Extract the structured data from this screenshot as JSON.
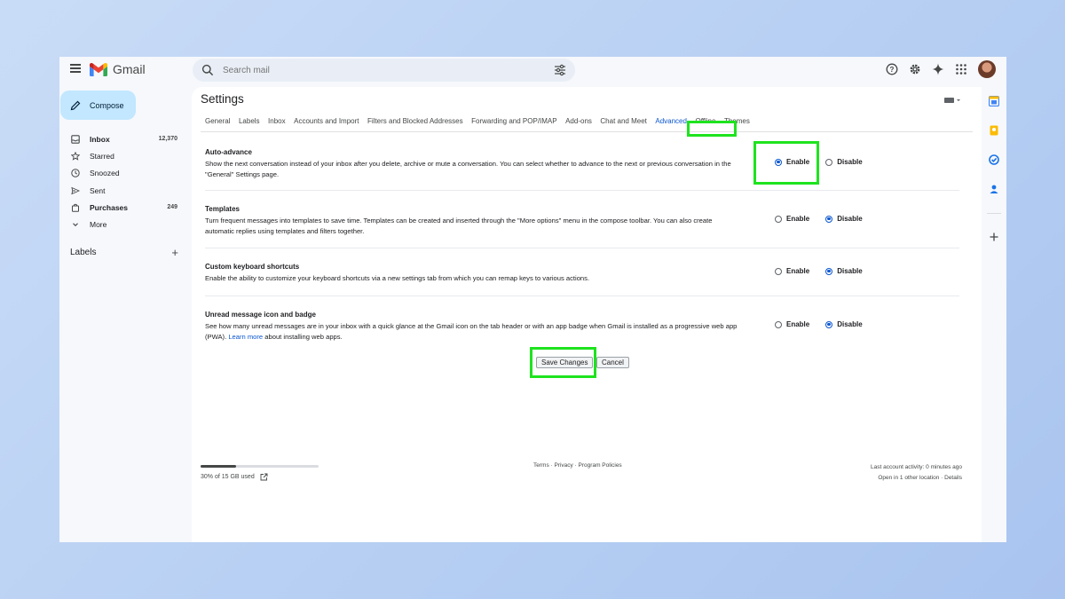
{
  "app": {
    "name": "Gmail"
  },
  "search": {
    "placeholder": "Search mail"
  },
  "compose": {
    "label": "Compose"
  },
  "sidebar": {
    "items": [
      {
        "label": "Inbox",
        "count": "12,370",
        "icon": "inbox-icon",
        "bold": true
      },
      {
        "label": "Starred",
        "count": "",
        "icon": "star-icon",
        "bold": false
      },
      {
        "label": "Snoozed",
        "count": "",
        "icon": "clock-icon",
        "bold": false
      },
      {
        "label": "Sent",
        "count": "",
        "icon": "send-icon",
        "bold": false
      },
      {
        "label": "Purchases",
        "count": "249",
        "icon": "bag-icon",
        "bold": true
      },
      {
        "label": "More",
        "count": "",
        "icon": "chevron-down-icon",
        "bold": false
      }
    ],
    "labels_header": "Labels"
  },
  "settings": {
    "title": "Settings",
    "tabs": [
      "General",
      "Labels",
      "Inbox",
      "Accounts and Import",
      "Filters and Blocked Addresses",
      "Forwarding and POP/IMAP",
      "Add-ons",
      "Chat and Meet",
      "Advanced",
      "Offline",
      "Themes"
    ],
    "active_tab": "Advanced",
    "rows": [
      {
        "title": "Auto-advance",
        "desc": "Show the next conversation instead of your inbox after you delete, archive or mute a conversation. You can select whether to advance to the next or previous conversation in the \"General\" Settings page.",
        "enable_label": "Enable",
        "disable_label": "Disable",
        "selected": "enable"
      },
      {
        "title": "Templates",
        "desc": "Turn frequent messages into templates to save time. Templates can be created and inserted through the \"More options\" menu in the compose toolbar. You can also create automatic replies using templates and filters together.",
        "enable_label": "Enable",
        "disable_label": "Disable",
        "selected": "disable"
      },
      {
        "title": "Custom keyboard shortcuts",
        "desc": "Enable the ability to customize your keyboard shortcuts via a new settings tab from which you can remap keys to various actions.",
        "enable_label": "Enable",
        "disable_label": "Disable",
        "selected": "disable"
      },
      {
        "title": "Unread message icon and badge",
        "desc": "See how many unread messages are in your inbox with a quick glance at the Gmail icon on the tab header or with an app badge when Gmail is installed as a progressive web app (PWA).",
        "link": "Learn more",
        "desc_after": "about installing web apps.",
        "enable_label": "Enable",
        "disable_label": "Disable",
        "selected": "disable"
      }
    ],
    "save_label": "Save Changes",
    "cancel_label": "Cancel"
  },
  "footer": {
    "storage_text": "30% of 15 GB used",
    "storage_fraction": 0.3,
    "links": "Terms · Privacy · Program Policies",
    "activity_line1": "Last account activity: 0 minutes ago",
    "activity_line2": "Open in 1 other location · Details"
  },
  "colors": {
    "accent": "#0b57d0",
    "compose_bg": "#c2e7ff",
    "highlight": "#1ee31e"
  }
}
